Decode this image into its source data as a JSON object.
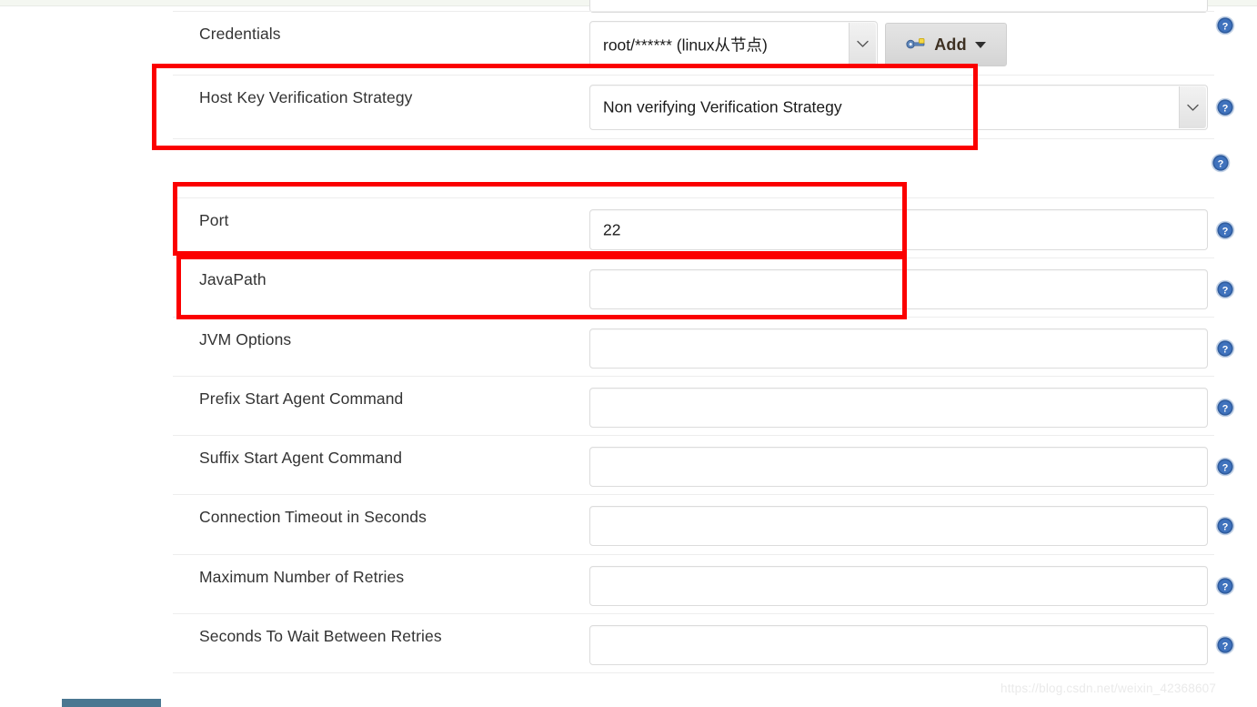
{
  "page": {
    "watermark": "https://blog.csdn.net/weixin_42368607"
  },
  "form": {
    "rows": [
      {
        "id": "credentials",
        "label": "Credentials",
        "control": "select",
        "value": "root/****** (linux从节点)",
        "has_add_button": true,
        "has_help": true
      },
      {
        "id": "host-key-verification-strategy",
        "label": "Host Key Verification Strategy",
        "control": "select",
        "value": "Non verifying Verification Strategy",
        "has_add_button": false,
        "has_help": true
      },
      {
        "id": "port",
        "label": "Port",
        "control": "input",
        "value": "22",
        "has_help": true
      },
      {
        "id": "javapath",
        "label": "JavaPath",
        "control": "input",
        "value": "",
        "has_help": true
      },
      {
        "id": "jvm-options",
        "label": "JVM Options",
        "control": "input",
        "value": "",
        "has_help": true
      },
      {
        "id": "prefix-start-agent-command",
        "label": "Prefix Start Agent Command",
        "control": "input",
        "value": "",
        "has_help": true
      },
      {
        "id": "suffix-start-agent-command",
        "label": "Suffix Start Agent Command",
        "control": "input",
        "value": "",
        "has_help": true
      },
      {
        "id": "connection-timeout-in-seconds",
        "label": "Connection Timeout in Seconds",
        "control": "input",
        "value": "",
        "has_help": true
      },
      {
        "id": "maximum-number-of-retries",
        "label": "Maximum Number of Retries",
        "control": "input",
        "value": "",
        "has_help": true
      },
      {
        "id": "seconds-to-wait-between-retries",
        "label": "Seconds To Wait Between Retries",
        "control": "input",
        "value": "",
        "has_help": true
      }
    ],
    "add_button": {
      "label": "Add",
      "icon": "key-icon",
      "caret": "chevron-down-icon"
    }
  },
  "annotations": {
    "boxes": [
      {
        "id": "host-key-verification-strategy-highlight",
        "color": "#fb0000"
      },
      {
        "id": "port-highlight",
        "color": "#fb0000"
      },
      {
        "id": "javapath-highlight",
        "color": "#fb0000"
      }
    ]
  },
  "colors": {
    "annotation_red": "#fb0000",
    "help_icon_blue": "#2f5c9e",
    "footer_bar": "#4a7791",
    "field_border": "#dcdcdc",
    "label_text": "#333333"
  }
}
